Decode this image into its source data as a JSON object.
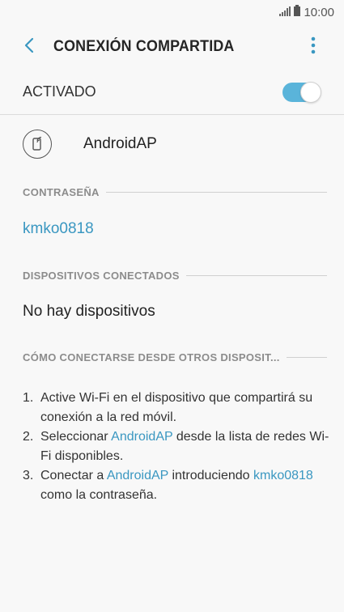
{
  "status_bar": {
    "time": "10:00",
    "signal_icon": "signal-icon",
    "battery_icon": "battery-icon"
  },
  "header": {
    "title": "CONEXIÓN COMPARTIDA",
    "back_icon": "back-arrow-icon",
    "more_icon": "more-vert-icon"
  },
  "switch": {
    "label": "ACTIVADO",
    "on": true,
    "accent": "#5ab4da"
  },
  "network": {
    "name": "AndroidAP",
    "icon": "hotspot-phone-icon"
  },
  "sections": {
    "password": {
      "header": "CONTRASEÑA",
      "value": "kmko0818"
    },
    "devices": {
      "header": "DISPOSITIVOS CONECTADOS",
      "value": "No hay dispositivos"
    },
    "howto": {
      "header": "CÓMO CONECTARSE DESDE OTROS DISPOSIT..."
    }
  },
  "instructions": [
    {
      "num": "1.",
      "parts": [
        "Active Wi-Fi en el dispositivo que compartirá su conexión a la red móvil."
      ]
    },
    {
      "num": "2.",
      "pre": "Seleccionar ",
      "hl": "AndroidAP",
      "post": " desde la lista de redes Wi-Fi disponibles."
    },
    {
      "num": "3.",
      "pre": "Conectar a ",
      "hl": "AndroidAP",
      "mid": " introduciendo ",
      "hl2": "kmko0818",
      "post": " como la contraseña."
    }
  ],
  "link_color": "#3a97c1"
}
